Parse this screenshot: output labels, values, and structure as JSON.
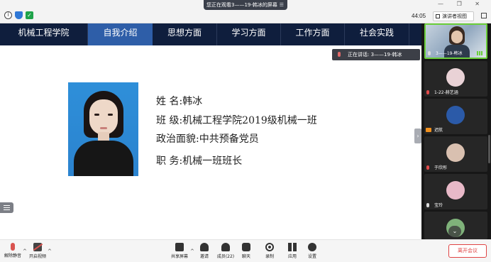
{
  "topbar": {
    "share_banner": "您正在观看3——19-韩冰的屏幕",
    "time": "44:05",
    "view_button": "演讲者视图",
    "info_glyph": "i",
    "check_glyph": "✓",
    "window_controls": "— ❐ ✕"
  },
  "nav": {
    "items": [
      {
        "label": "机械工程学院",
        "active": false
      },
      {
        "label": "自我介绍",
        "active": true
      },
      {
        "label": "思想方面",
        "active": false
      },
      {
        "label": "学习方面",
        "active": false
      },
      {
        "label": "工作方面",
        "active": false
      },
      {
        "label": "社会实践",
        "active": false
      }
    ]
  },
  "speaking_banner": "正在讲话: 3——19-韩冰",
  "profile": {
    "rows": [
      {
        "label": "姓    名:",
        "value": "韩冰"
      },
      {
        "label": "班    级:",
        "value": "机械工程学院2019级机械一班"
      },
      {
        "label": "政治面貌:",
        "value": "中共预备党员"
      },
      {
        "label": "职    务:",
        "value": "机械一班班长"
      }
    ]
  },
  "gallery": {
    "tiles": [
      {
        "name": "3——19-韩冰",
        "type": "video",
        "mic": "on"
      },
      {
        "name": "1-22-赫艺涵",
        "type": "avatar",
        "mic": "off",
        "avatar_color": "#e9d2d6"
      },
      {
        "name": "迟航",
        "type": "avatar",
        "mic": "none",
        "avatar_color": "#2b5aa8"
      },
      {
        "name": "于欣彤",
        "type": "avatar",
        "mic": "off",
        "avatar_color": "#d9c0b0"
      },
      {
        "name": "宝玲",
        "type": "avatar",
        "mic": "on",
        "avatar_color": "#e8b9c8"
      },
      {
        "name": "",
        "type": "avatar",
        "mic": "none",
        "avatar_color": "#7fb27a"
      }
    ],
    "scroll_glyph": "⌄"
  },
  "toolbar": {
    "mute": "解除静音",
    "video": "开启视频",
    "share": "共享屏幕",
    "invite": "邀请",
    "members": "成员(22)",
    "chat": "聊天",
    "record": "录制",
    "apps": "应用",
    "settings": "设置",
    "leave": "离开会议",
    "caret": "^"
  },
  "side": {
    "collapse_glyph": "›"
  },
  "colors": {
    "nav_bg": "#0f1e3d",
    "nav_active": "#2e5ea8",
    "photo_bg": "#2e8fd9",
    "leave_red": "#e04444",
    "active_speaker": "#6bcf3a"
  }
}
